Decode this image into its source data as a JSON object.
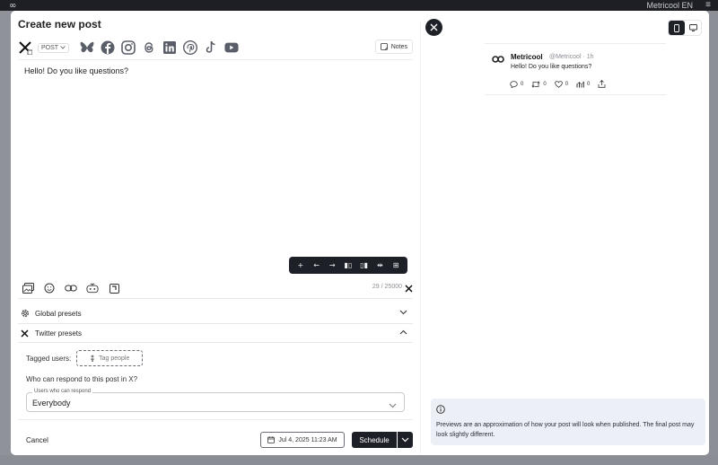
{
  "background": {
    "logo_icon": "∞",
    "account": "Metricool EN",
    "menu_icon": "≡"
  },
  "modal": {
    "title": "Create new post",
    "post_type": "POST",
    "networks": [
      "x-icon",
      "bluesky-icon",
      "facebook-icon",
      "instagram-icon",
      "threads-icon",
      "linkedin-icon",
      "pinterest-icon",
      "tiktok-icon",
      "youtube-icon"
    ],
    "notes_label": "Notes",
    "editor_text": "Hello! Do you like questions?",
    "format_toolbar": [
      "+",
      "←",
      "→",
      "▮▯",
      "▯▮",
      "⇹",
      "⊞"
    ],
    "char_count": "29 / 25000",
    "global_presets_label": "Global presets",
    "twitter_presets_label": "Twitter presets",
    "tagged_users_label": "Tagged users:",
    "tag_people_label": "Tag people",
    "respond_question": "Who can respond to this post in X?",
    "respond_legend": "Users who can respond",
    "respond_value": "Everybody",
    "cancel_label": "Cancel",
    "date_label": "Jul 4, 2025 11:23 AM",
    "schedule_label": "Schedule"
  },
  "preview": {
    "tweet": {
      "name": "Metricool",
      "handle": "@Metricool · 1h",
      "text": "Hello! Do you like questions?",
      "reply_count": "0",
      "retweet_count": "0",
      "like_count": "0",
      "views_count": "0"
    },
    "info_text": "Previews are an approximation of how your post will look when published. The final post may look slightly different."
  },
  "colors": {
    "dark": "#1e2028",
    "info_bg": "#eceff6",
    "overlay": "#8a8d93"
  }
}
